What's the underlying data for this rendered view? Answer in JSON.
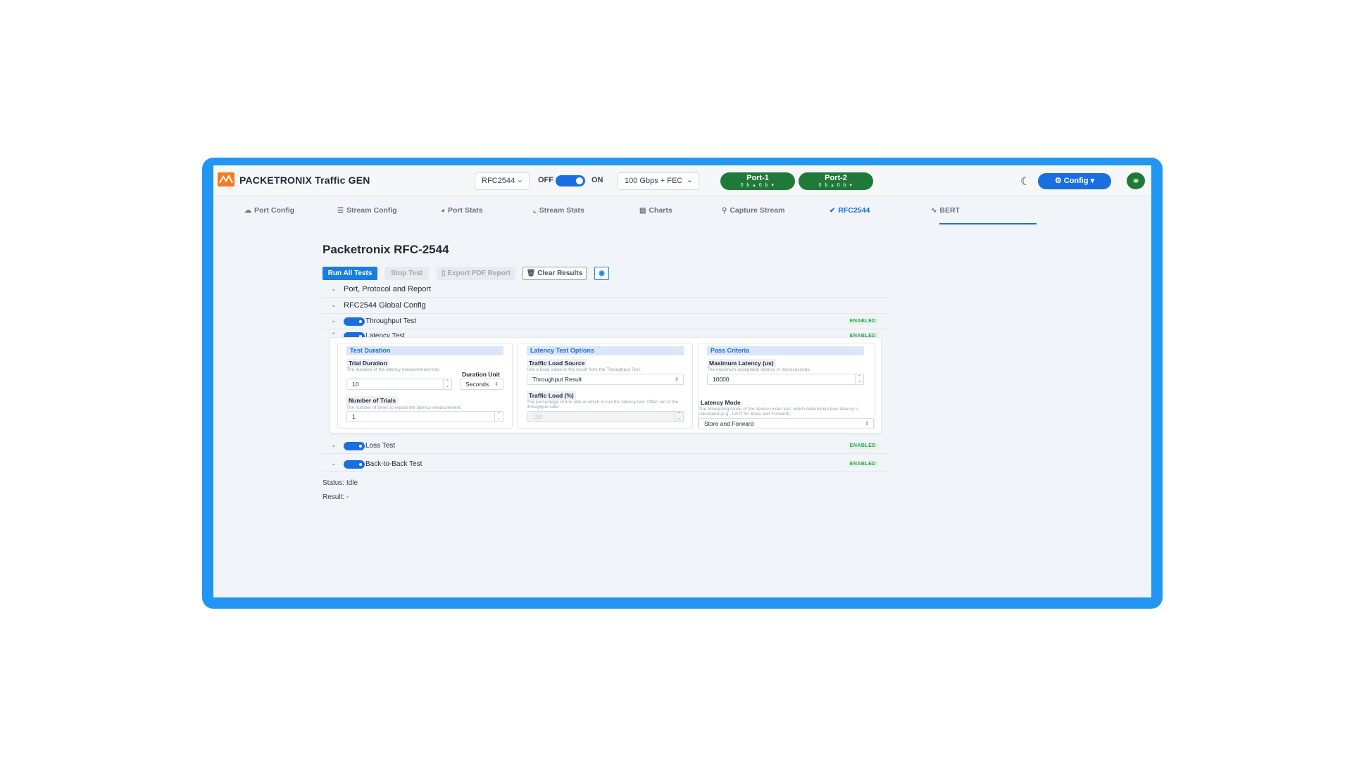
{
  "app": {
    "title": "PACKETRONIX Traffic GEN"
  },
  "header": {
    "test_select": "RFC2544",
    "power_off_label": "OFF",
    "power_on_label": "ON",
    "power_state": "on",
    "speed_select": "100 Gbps + FEC",
    "ports": [
      {
        "name": "Port-1",
        "stats": "0 b ▴  0 b ▾"
      },
      {
        "name": "Port-2",
        "stats": "0 b ▴  0 b ▾"
      }
    ],
    "config_label": "Config ▾"
  },
  "tabs": [
    {
      "label": "Port Config",
      "icon": "☁",
      "active": false
    },
    {
      "label": "Stream Config",
      "icon": "☰",
      "active": false
    },
    {
      "label": "Port Stats",
      "icon": "◕",
      "active": false
    },
    {
      "label": "Stream Stats",
      "icon": "⌞",
      "active": false
    },
    {
      "label": "Charts",
      "icon": "▤",
      "active": false
    },
    {
      "label": "Capture Stream",
      "icon": "⚲",
      "active": false
    },
    {
      "label": "RFC2544",
      "icon": "✔",
      "active": true
    },
    {
      "label": "BERT",
      "icon": "∿",
      "active": false
    }
  ],
  "page": {
    "title": "Packetronix RFC-2544",
    "buttons": {
      "run_all": "Run All Tests",
      "stop": "Stop Test",
      "export": "Export PDF Report",
      "clear": "Clear Results"
    },
    "sections": [
      {
        "title": "Port, Protocol and Report"
      },
      {
        "title": "RFC2544 Global Config"
      },
      {
        "title": "Throughput Test",
        "badge": "ENABLED",
        "enabled": true
      },
      {
        "title": "Latency Test",
        "badge": "ENABLED",
        "enabled": true
      },
      {
        "title": "Loss Test",
        "badge": "ENABLED",
        "enabled": true
      },
      {
        "title": "Back-to-Back Test",
        "badge": "ENABLED",
        "enabled": true
      }
    ],
    "latency": {
      "test_duration": {
        "heading": "Test Duration",
        "trial_duration_label": "Trial Duration",
        "trial_duration_desc": "The duration of the latency measurement trial.",
        "trial_duration_value": "10",
        "duration_unit_label": "Duration Unit",
        "duration_unit_value": "Seconds",
        "num_trials_label": "Number of Trials",
        "num_trials_desc": "The number of times to repeat the latency measurement.",
        "num_trials_value": "1"
      },
      "options": {
        "heading": "Latency Test Options",
        "load_source_label": "Traffic Load Source",
        "load_source_desc": "Use a fixed value or the result from the Throughput Test.",
        "load_source_value": "Throughput Result",
        "load_pct_label": "Traffic Load (%)",
        "load_pct_desc": "The percentage of line rate at which to run the latency test. Often set to the throughput rate.",
        "load_pct_value": "100"
      },
      "pass": {
        "heading": "Pass Criteria",
        "max_latency_label": "Maximum Latency (us)",
        "max_latency_desc": "The maximum acceptable latency in microseconds.",
        "max_latency_value": "10000",
        "mode_label": "Latency Mode",
        "mode_desc": "The forwarding mode of the device under test, which determines how latency is calculated (e.g., LIFO for Store and Forward).",
        "mode_value": "Store and Forward"
      }
    },
    "status": "Status: Idle",
    "result": "Result: -"
  },
  "colors": {
    "frame": "#2196f3",
    "accent": "#1a6fe0",
    "port_green": "#1f7a3a",
    "logo_orange": "#f47b20",
    "enabled_green": "#2e9e57"
  }
}
